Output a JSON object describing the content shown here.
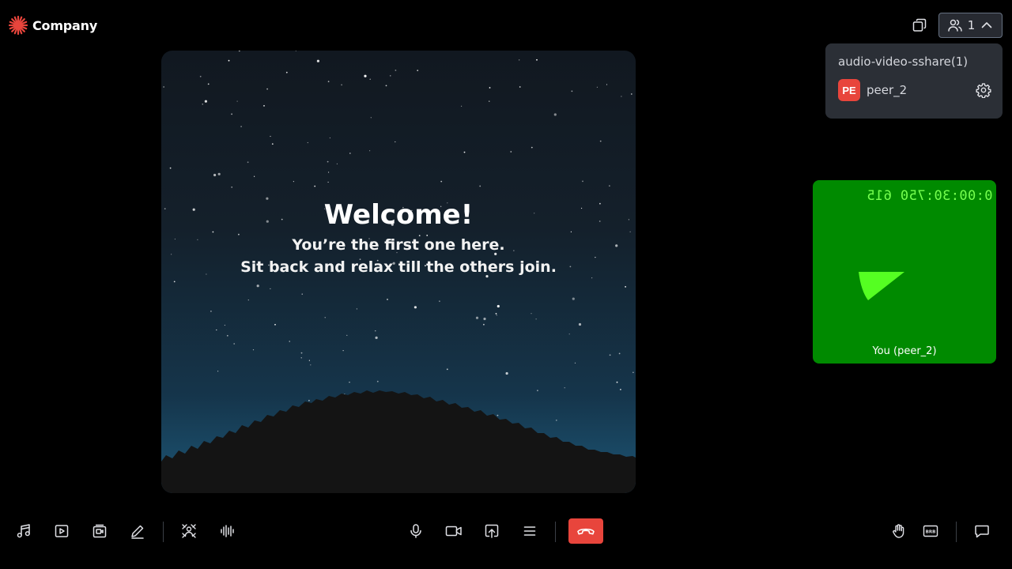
{
  "header": {
    "brand_name": "Company",
    "brand_color": "#e8453c",
    "participant_count": "1",
    "participant_icon": "people-icon",
    "pip_icon": "picture-in-picture-icon",
    "expand_icon": "chevron-up-icon"
  },
  "participants_popover": {
    "role_label": "audio-video-sshare(1)",
    "peers": [
      {
        "initials": "PE",
        "name": "peer_2",
        "avatar_color": "#e8453c",
        "settings_icon": "gear-icon"
      }
    ]
  },
  "main_tile": {
    "title": "Welcome!",
    "line1": "You’re the first one here.",
    "line2": "Sit back and relax till the others join."
  },
  "self_tile": {
    "timer_text": "0:00:30:750 615",
    "name": "You (peer_2)",
    "background": "#008a00",
    "accent": "#55ff22"
  },
  "toolbar": {
    "left": [
      "music-icon",
      "play-video-icon",
      "video-gallery-icon",
      "pencil-icon",
      "virtual-background-icon",
      "audio-waveform-icon"
    ],
    "center": [
      "microphone-icon",
      "video-camera-icon",
      "screen-share-icon",
      "menu-icon"
    ],
    "leave": {
      "icon": "hang-up-icon",
      "color": "#e8453c"
    },
    "right": [
      "raise-hand-icon",
      "brb-icon",
      "chat-icon"
    ]
  }
}
